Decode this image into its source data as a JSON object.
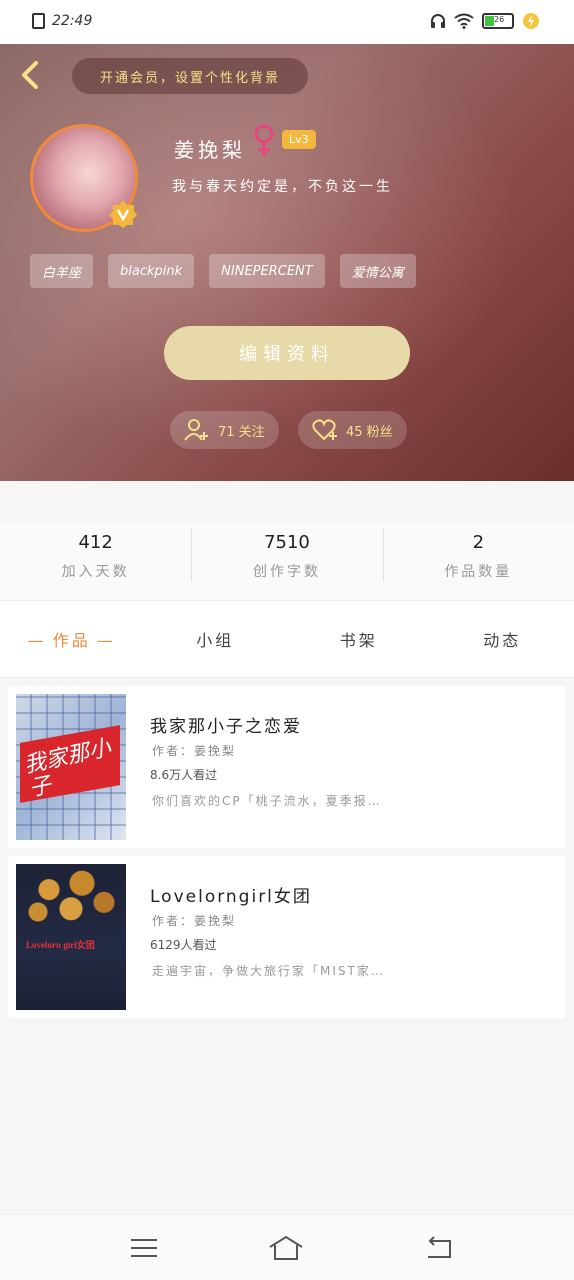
{
  "status_bar": {
    "time": "22:49",
    "battery": "26"
  },
  "header": {
    "vip_banner": "开通会员，设置个性化背景"
  },
  "profile": {
    "name": "姜挽梨",
    "level": "Lv3",
    "signature": "我与春天约定是，不负这一生",
    "tags": [
      "白羊座",
      "blackpink",
      "NINEPERCENT",
      "爱情公寓"
    ],
    "edit_button": "编辑资料",
    "following": "71 关注",
    "fans": "45 粉丝"
  },
  "stats": [
    {
      "value": "412",
      "label": "加入天数"
    },
    {
      "value": "7510",
      "label": "创作字数"
    },
    {
      "value": "2",
      "label": "作品数量"
    }
  ],
  "tabs": [
    "作品",
    "小组",
    "书架",
    "动态"
  ],
  "works": [
    {
      "title": "我家那小子之恋爱",
      "author": "作者：姜挽梨",
      "views": "8.6万人看过",
      "description": "你们喜欢的CP「桃子流水，夏季报…",
      "cover_text": "我家那小子"
    },
    {
      "title": "Lovelorngirl女团",
      "author": "作者：姜挽梨",
      "views": "6129人看过",
      "description": "走遍宇宙，争做大旅行家「MIST家…",
      "cover_text": "Lovelorn girl女团"
    }
  ],
  "colors": {
    "accent": "#ef8a3c",
    "gold": "#f5e28a",
    "level": "#f2b73c"
  }
}
